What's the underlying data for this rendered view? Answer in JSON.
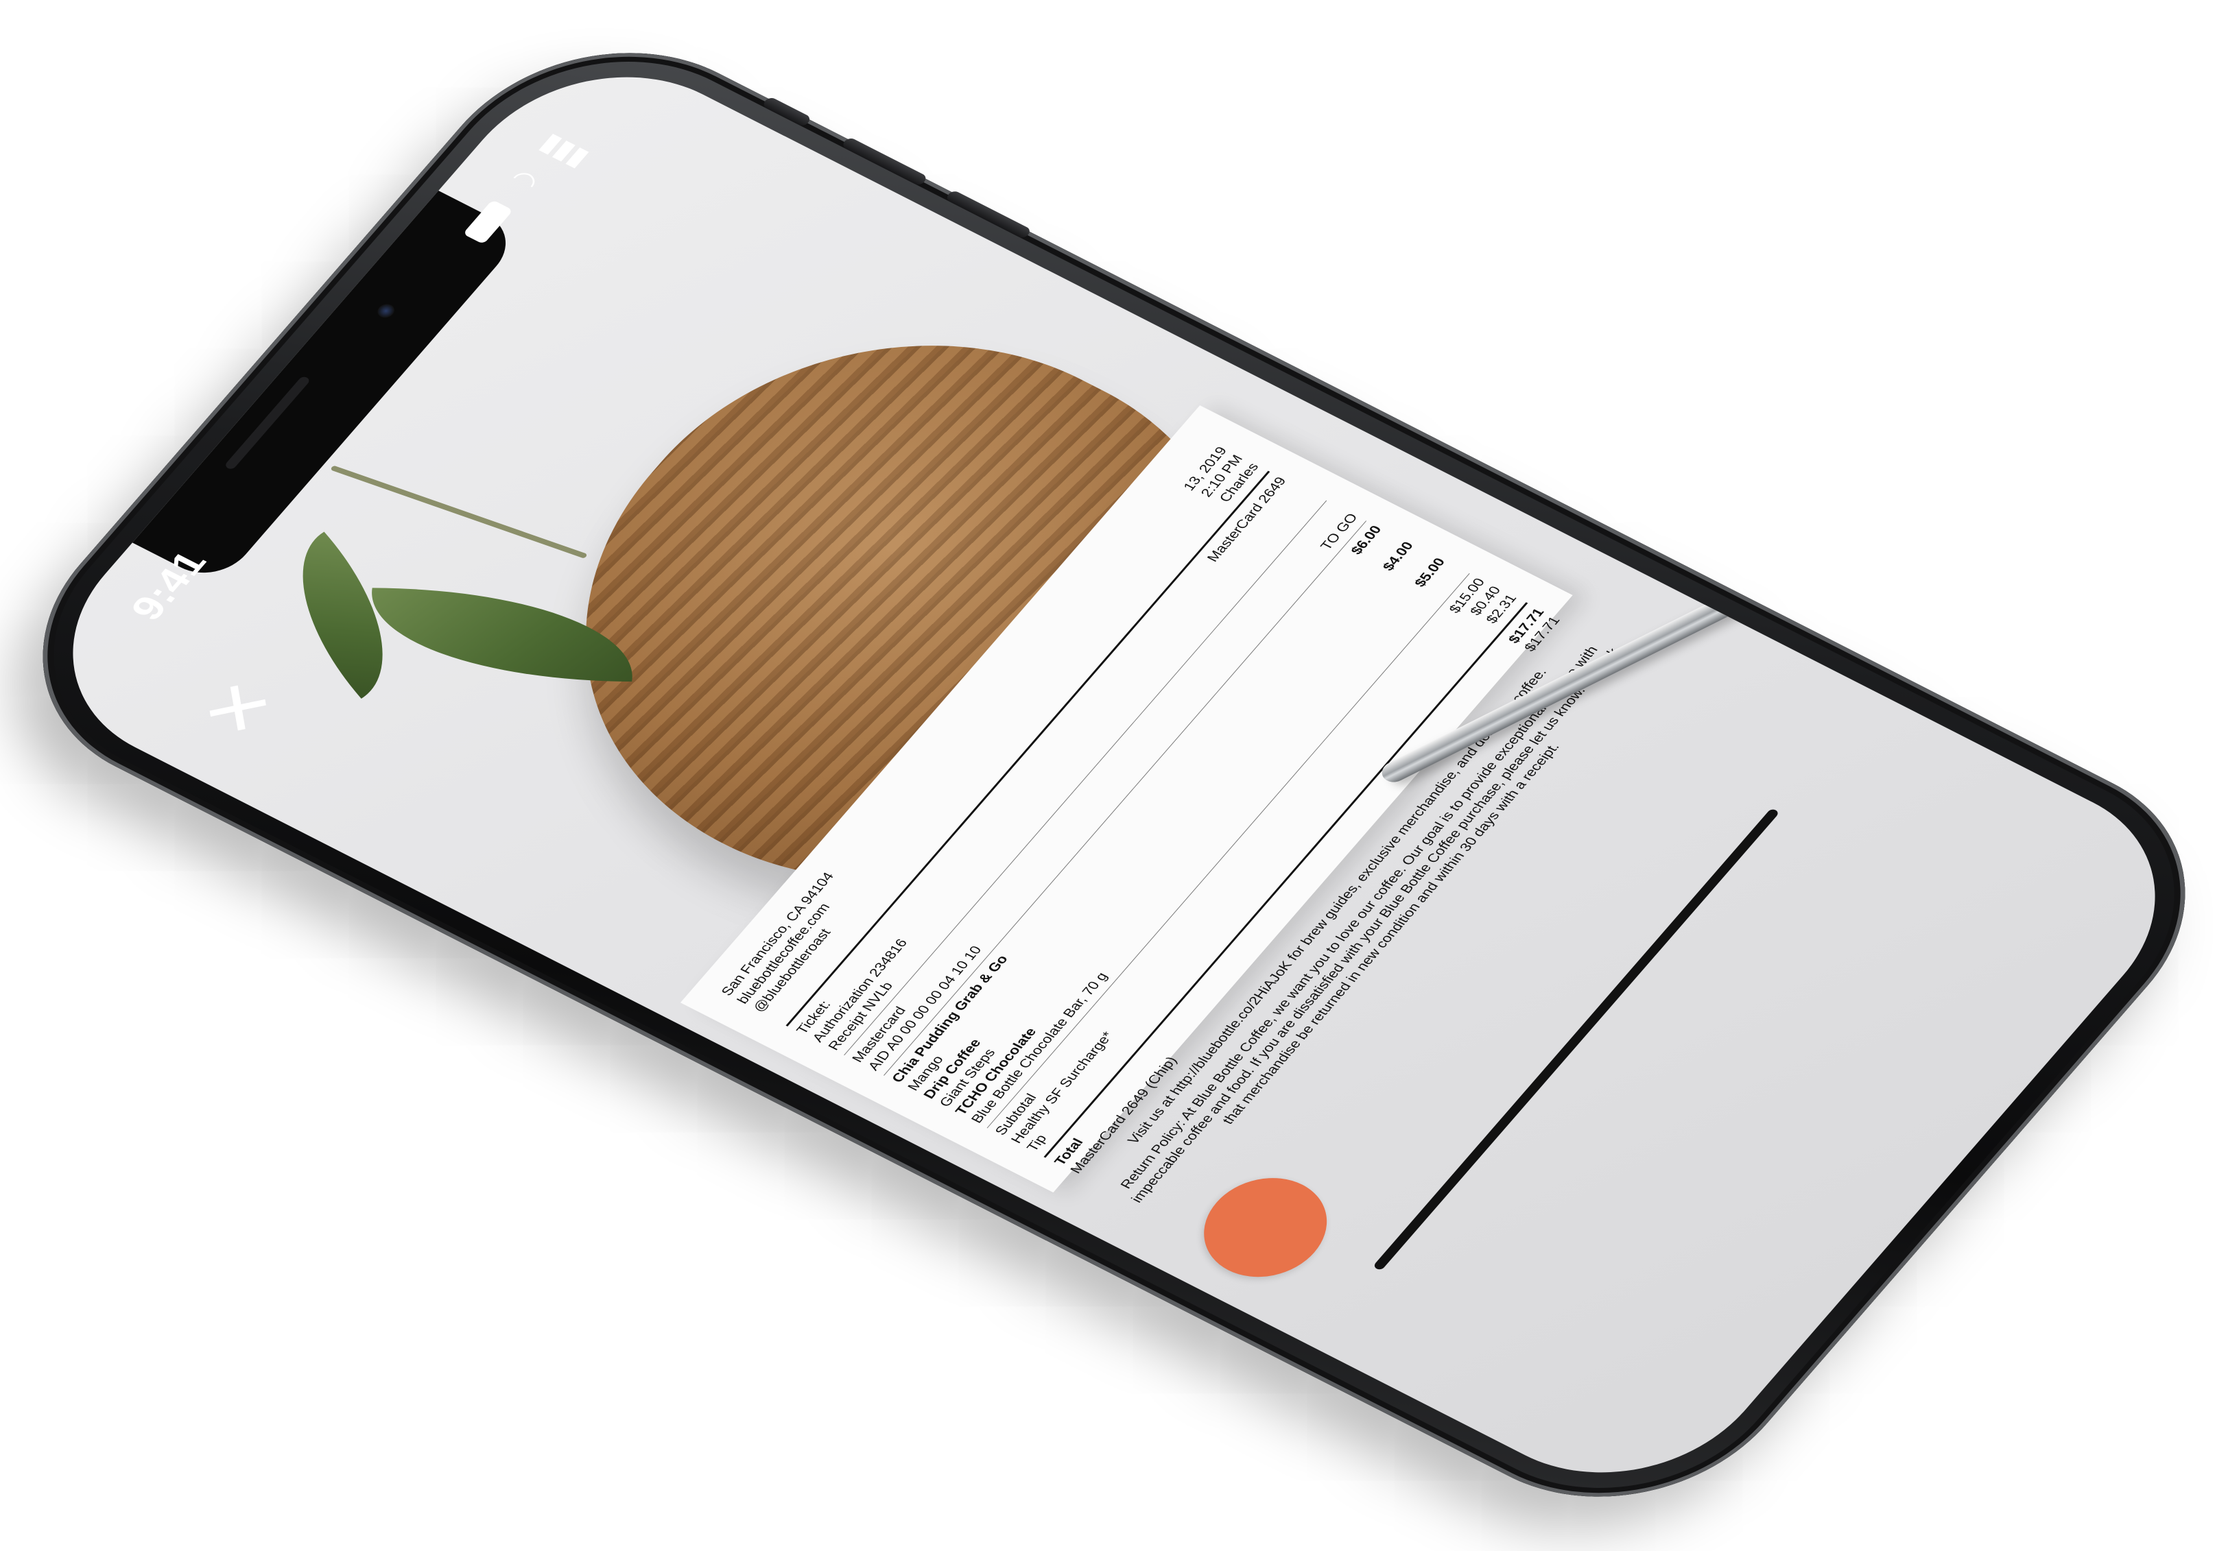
{
  "status_bar": {
    "time": "9:41",
    "icons": [
      "signal-icon",
      "wifi-icon",
      "battery-icon"
    ]
  },
  "controls": {
    "close_label": "✕",
    "capture_color": "#e8734a"
  },
  "receipt": {
    "header_lines": [
      "San Francisco, CA 94104",
      "bluebottlecoffee.com",
      "@bluebottleroast"
    ],
    "date": "13, 2019",
    "time": "2:10 PM",
    "server": "Charles",
    "ticket_label": "Ticket:",
    "authorization": "Authorization 234816",
    "receipt_id": "Receipt NVLb",
    "card_right": "MasterCard 2649",
    "card_type": "Mastercard",
    "aid": "AID A0 00 00 00 04 10 10",
    "to_go": "TO GO",
    "items": [
      {
        "name": "Chia Pudding Grab & Go",
        "price": "$6.00"
      },
      {
        "name": "Mango",
        "price": ""
      },
      {
        "name": "Drip Coffee",
        "price": "$4.00"
      },
      {
        "name": "Giant Steps",
        "price": ""
      },
      {
        "name": "TCHO Chocolate",
        "price": "$5.00"
      },
      {
        "name": "Blue Bottle Chocolate Bar, 70 g",
        "price": ""
      }
    ],
    "subtotal_label": "Subtotal",
    "subtotal": "$15.00",
    "surcharge_label": "Healthy SF Surcharge*",
    "surcharge": "$0.40",
    "tip_label": "Tip",
    "tip": "$2.31",
    "total_label": "Total",
    "total": "$17.71",
    "card_charge_label": "MasterCard 2649 (Chip)",
    "card_charge": "$17.71",
    "visit_text": "Visit us at http://bluebottle.co/2HiAJoK for brew guides, exclusive merchandise, and delicious coffee.",
    "return_text": "Return Policy: At Blue Bottle Coffee, we want you to love our coffee. Our goal is to provide exceptional service with impeccable coffee and food. If you are dissatisfied with your Blue Bottle Coffee purchase, please let us know. We ask that merchandise be returned in new condition and within 30 days with a receipt."
  }
}
